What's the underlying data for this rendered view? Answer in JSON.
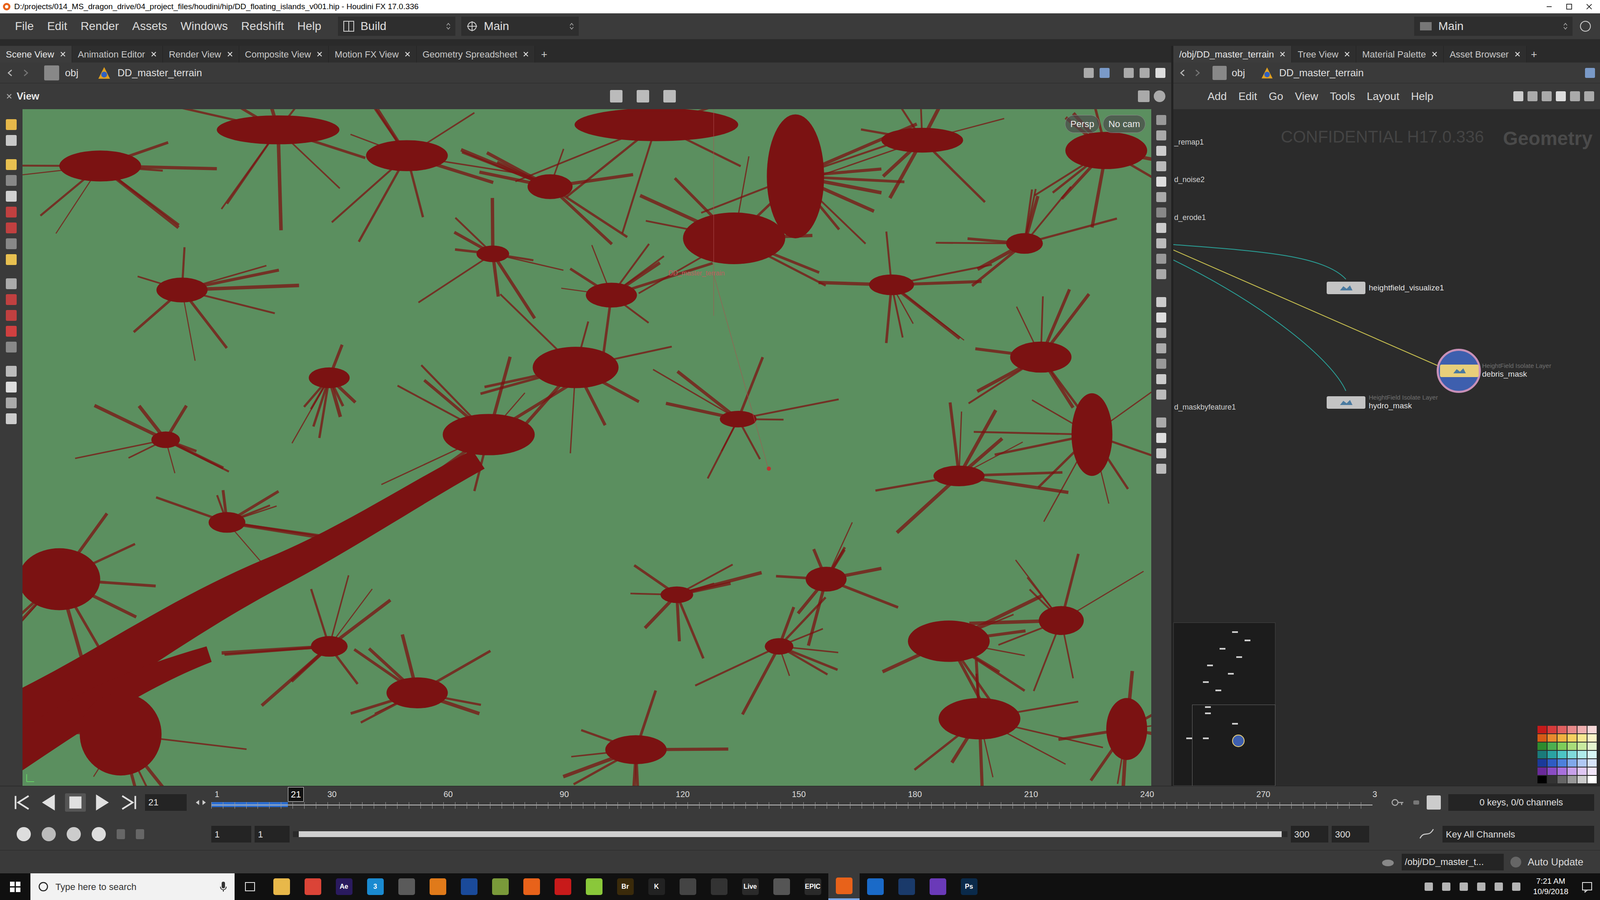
{
  "window": {
    "title": "D:/projects/014_MS_dragon_drive/04_project_files/houdini/hip/DD_floating_islands_v001.hip - Houdini FX 17.0.336"
  },
  "menu": [
    "File",
    "Edit",
    "Render",
    "Assets",
    "Windows",
    "Redshift",
    "Help"
  ],
  "desktop": {
    "label": "Build"
  },
  "context": {
    "label": "Main"
  },
  "right_desktop": {
    "label": "Main"
  },
  "left_tabs": [
    {
      "label": "Scene View",
      "selected": true
    },
    {
      "label": "Animation Editor",
      "selected": false
    },
    {
      "label": "Render View",
      "selected": false
    },
    {
      "label": "Composite View",
      "selected": false
    },
    {
      "label": "Motion FX View",
      "selected": false
    },
    {
      "label": "Geometry Spreadsheet",
      "selected": false
    }
  ],
  "right_tabs": [
    {
      "label": "/obj/DD_master_terrain",
      "selected": true
    },
    {
      "label": "Tree View",
      "selected": false
    },
    {
      "label": "Material Palette",
      "selected": false
    },
    {
      "label": "Asset Browser",
      "selected": false
    }
  ],
  "add_tab": "+",
  "path": {
    "root": "obj",
    "node": "DD_master_terrain"
  },
  "viewport": {
    "label": "View",
    "object_label": "DD_master_terrain",
    "camera_buttons": [
      "Persp",
      "No cam"
    ]
  },
  "network": {
    "menu": [
      "Add",
      "Edit",
      "Go",
      "View",
      "Tools",
      "Layout",
      "Help"
    ],
    "watermark": "CONFIDENTIAL H17.0.336",
    "context": "Geometry",
    "partial_nodes": [
      "_remap1",
      "d_noise2",
      "d_erode1",
      "d_maskbyfeature1"
    ],
    "nodes": [
      {
        "name": "heightfield_visualize1",
        "type": "",
        "selected": false
      },
      {
        "name": "hydro_mask",
        "type": "HeightField Isolate Layer",
        "selected": false
      },
      {
        "name": "debris_mask",
        "type": "HeightField Isolate Layer",
        "selected": true
      }
    ]
  },
  "palette": {
    "colors": [
      "#c41a1a",
      "#d63b3b",
      "#e06060",
      "#e88a8a",
      "#f0b0b0",
      "#f7d8d8",
      "#d65a16",
      "#e88a2e",
      "#f0b040",
      "#f5d060",
      "#f7e890",
      "#fbf4c8",
      "#2e8b2e",
      "#4caf50",
      "#7ccc5a",
      "#a8dc7a",
      "#c8eaa0",
      "#e4f4d0",
      "#1a7a7a",
      "#2aa3a3",
      "#4cc4c4",
      "#80dada",
      "#b0eaea",
      "#d8f6f6",
      "#1a3a9a",
      "#2e5cc4",
      "#4c80dc",
      "#80a8ea",
      "#b0c8f4",
      "#d8e4fa",
      "#6a2a9a",
      "#8a4cc4",
      "#a870dc",
      "#c8a0ea",
      "#e0c8f4",
      "#f2e6fa",
      "#000000",
      "#333333",
      "#666666",
      "#999999",
      "#cccccc",
      "#ffffff"
    ]
  },
  "timeline": {
    "current_frame": "21",
    "playhead": "21",
    "level": 0.066,
    "ticks": [
      "1",
      "30",
      "60",
      "90",
      "120",
      "150",
      "180",
      "210",
      "240",
      "270",
      "3"
    ],
    "start": "1",
    "range_start": "1",
    "range_end": "300",
    "end": "300",
    "keys": "0 keys, 0/0 channels",
    "key_all": "Key All Channels"
  },
  "status": {
    "path": "/obj/DD_master_t...",
    "update": "Auto Update"
  },
  "taskbar": {
    "search": "Type here to search",
    "time": "7:21 AM",
    "date": "10/9/2018",
    "apps": [
      {
        "label": "",
        "color": "#e8b84a",
        "selected": false
      },
      {
        "label": "",
        "color": "#db4437",
        "selected": false
      },
      {
        "label": "Ae",
        "color": "#2a1a5e",
        "selected": false
      },
      {
        "label": "3",
        "color": "#1a8ad0",
        "selected": false
      },
      {
        "label": "",
        "color": "#5a5a5a",
        "selected": false
      },
      {
        "label": "",
        "color": "#e07a1a",
        "selected": false
      },
      {
        "label": "",
        "color": "#1a4a9a",
        "selected": false
      },
      {
        "label": "",
        "color": "#7a9a3a",
        "selected": false
      },
      {
        "label": "",
        "color": "#e8621a",
        "selected": false
      },
      {
        "label": "",
        "color": "#c81a1a",
        "selected": false
      },
      {
        "label": "",
        "color": "#8ac83a",
        "selected": false
      },
      {
        "label": "Br",
        "color": "#3a2a0a",
        "selected": false
      },
      {
        "label": "K",
        "color": "#222222",
        "selected": false
      },
      {
        "label": "",
        "color": "#444444",
        "selected": false
      },
      {
        "label": "",
        "color": "#333333",
        "selected": false
      },
      {
        "label": "Live",
        "color": "#2a2a2a",
        "selected": false
      },
      {
        "label": "",
        "color": "#555555",
        "selected": false
      },
      {
        "label": "EPIC",
        "color": "#2a2a2a",
        "selected": false
      },
      {
        "label": "",
        "color": "#e8621a",
        "selected": true
      },
      {
        "label": "",
        "color": "#1a6ac8",
        "selected": false
      },
      {
        "label": "",
        "color": "#1a3a6a",
        "selected": false
      },
      {
        "label": "",
        "color": "#6a3ab8",
        "selected": false
      },
      {
        "label": "Ps",
        "color": "#0a2a4a",
        "selected": false
      }
    ]
  }
}
